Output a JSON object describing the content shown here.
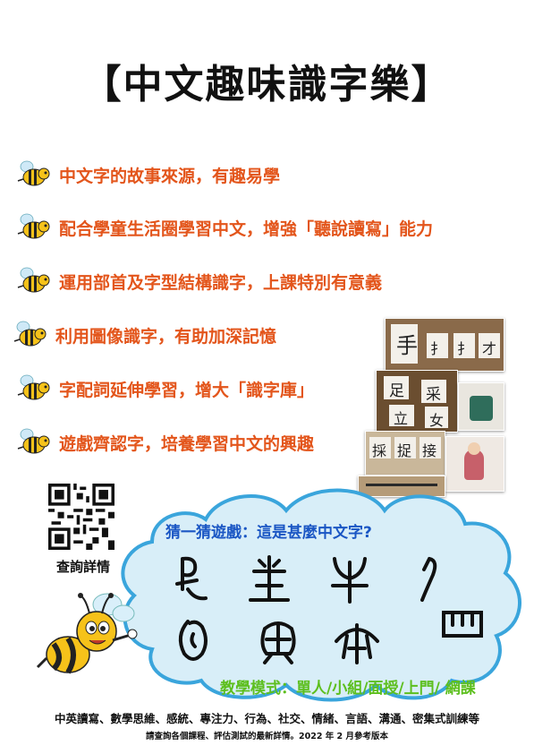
{
  "title": "【中文趣味識字樂】",
  "features": [
    "中文字的故事來源，有趣易學",
    "配合學童生活圈學習中文，增強「聽說讀寫」能力",
    "運用部首及字型結構識字，上課特別有意義",
    "利用圖像識字，有助加深記憶",
    "字配詞延伸學習，增大「識字庫」",
    "遊戲齊認字，培養學習中文的興趣"
  ],
  "qr_label": "查詢詳情",
  "game_title": "猜一猜遊戲：這是甚麼中文字?",
  "teaching_mode": "教學模式：單人/小組/面授/上門/ 網課",
  "services": "中英讀寫、數學思維、感統、專注力、行為、社交、情緒、言語、溝通、密集式訓練等",
  "footer": "請查詢各個課程、評估測試的最新詳情。2022 年 2 月參考版本",
  "photo_text": {
    "photo1": [
      "手",
      "扌",
      "扌",
      "才"
    ],
    "photo2": [
      "足",
      "采",
      "立",
      "女"
    ],
    "photo3": [
      "採",
      "捉",
      "接"
    ]
  },
  "colors": {
    "feature_text": "#e3551b",
    "game_title": "#1a56c4",
    "teaching_mode": "#5dbf1e",
    "cloud_fill": "#d8eef8",
    "cloud_stroke": "#3aa5dc"
  }
}
